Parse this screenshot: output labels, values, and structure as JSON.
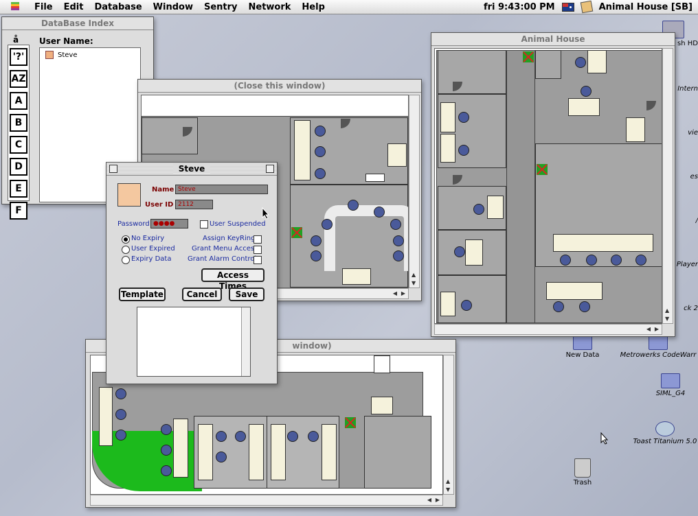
{
  "menubar": {
    "items": [
      "File",
      "Edit",
      "Database",
      "Window",
      "Sentry",
      "Network",
      "Help"
    ],
    "clock": "fri 9:43:00 PM",
    "app_name": "Animal House [SB]"
  },
  "db_index": {
    "title": "DataBase Index",
    "col_header_a": "å",
    "col_header_name": "User Name:",
    "letters": [
      "'?'",
      "AZ",
      "A",
      "B",
      "C",
      "D",
      "E",
      "F"
    ],
    "users": [
      "Steve"
    ]
  },
  "map_window_1": {
    "title": "(Close this window)"
  },
  "map_window_2": {
    "title": "window)"
  },
  "animal_house": {
    "title": "Animal House"
  },
  "user_dialog": {
    "title": "Steve",
    "name_label": "Name",
    "name_value": "Steve",
    "userid_label": "User ID",
    "userid_value": "2112",
    "password_label": "Password",
    "password_value": "●●●●",
    "user_suspended": "User Suspended",
    "no_expiry": "No Expiry",
    "user_expired": "User Expired",
    "expiry_data": "Expiry Data",
    "assign_keyring": "Assign KeyRing",
    "grant_menu": "Grant Menu Access",
    "grant_alarm": "Grant Alarm Control",
    "access_times": "Access Times",
    "template": "Template",
    "cancel": "Cancel",
    "save": "Save"
  },
  "desktop": {
    "icons": [
      "sh HD",
      "Intern",
      "vie",
      "es",
      "/",
      "e Player",
      "ck 2",
      "New Data",
      "Metrowerks CodeWarr",
      "SIML_G4",
      "Toast Titanium 5.0",
      "Trash"
    ]
  }
}
